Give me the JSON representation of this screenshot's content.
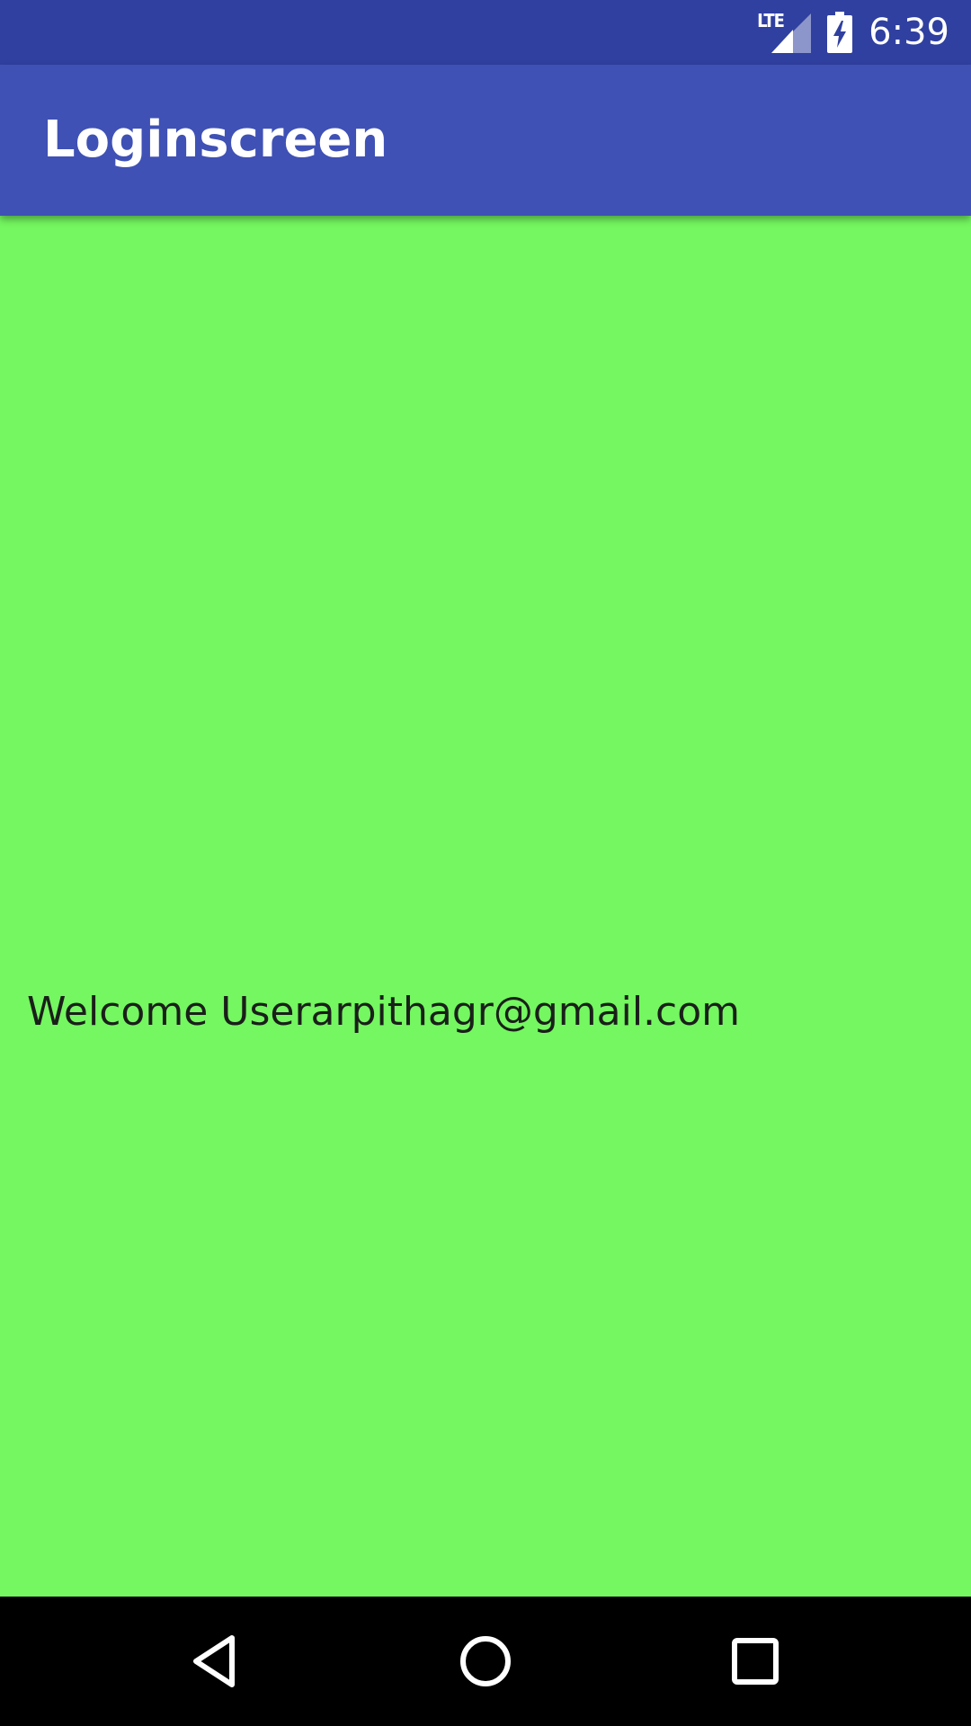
{
  "status_bar": {
    "network_label": "LTE",
    "signal_icon": "cellular-signal-icon",
    "battery_icon": "battery-charging-icon",
    "time": "6:39"
  },
  "app_bar": {
    "title": "Loginscreen"
  },
  "content": {
    "welcome_message": "Welcome Userarpithagr@gmail.com"
  },
  "nav_bar": {
    "back_icon": "back-icon",
    "home_icon": "home-icon",
    "recents_icon": "recents-icon"
  },
  "colors": {
    "status_bar": "#3040a0",
    "app_bar": "#3f51b5",
    "content_background": "#74f760",
    "nav_bar": "#000000",
    "welcome_text": "#1a1f1a"
  }
}
